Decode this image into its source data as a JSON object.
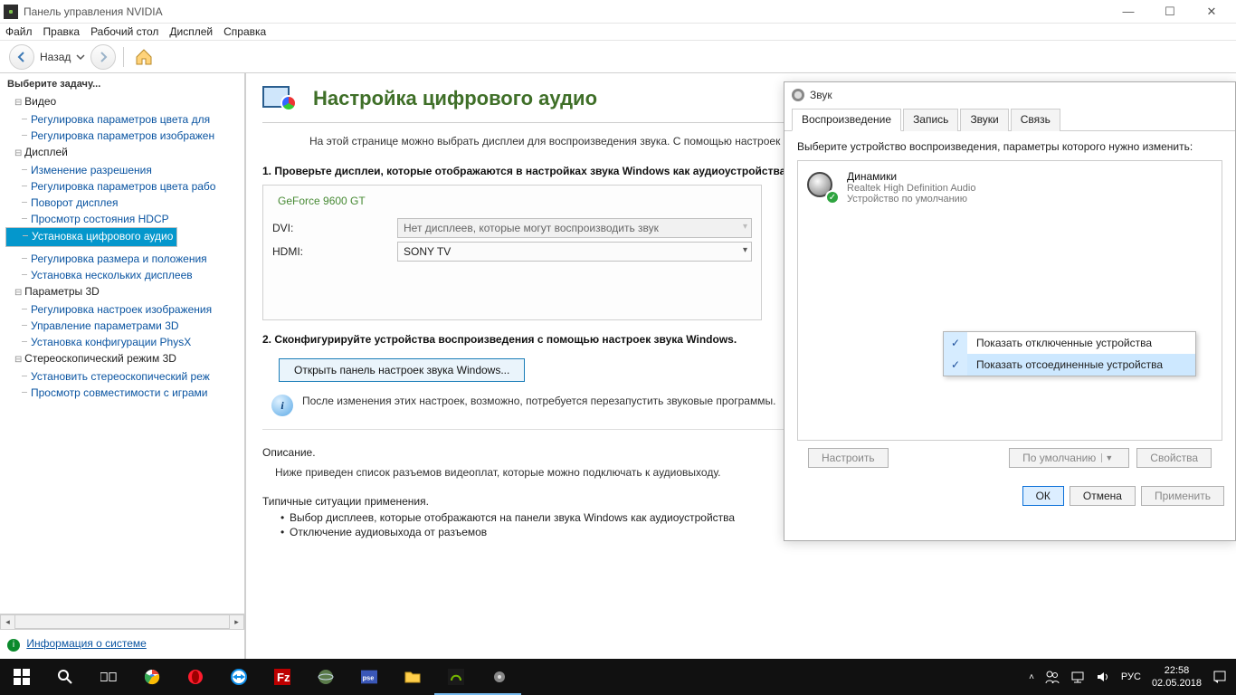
{
  "titlebar": {
    "title": "Панель управления NVIDIA"
  },
  "menubar": [
    "Файл",
    "Правка",
    "Рабочий стол",
    "Дисплей",
    "Справка"
  ],
  "nav": {
    "back": "Назад"
  },
  "leftpane_header": "Выберите задачу...",
  "tree": [
    {
      "group": "Видео",
      "items": [
        "Регулировка параметров цвета для",
        "Регулировка параметров изображен"
      ]
    },
    {
      "group": "Дисплей",
      "items": [
        "Изменение разрешения",
        "Регулировка параметров цвета рабо",
        "Поворот дисплея",
        "Просмотр состояния HDCP",
        "Установка цифрового аудио",
        "Регулировка размера и положения",
        "Установка нескольких дисплеев"
      ]
    },
    {
      "group": "Параметры 3D",
      "items": [
        "Регулировка настроек изображения",
        "Управление параметрами 3D",
        "Установка конфигурации PhysX"
      ]
    },
    {
      "group": "Стереоскопический режим 3D",
      "items": [
        "Установить стереоскопический реж",
        "Просмотр совместимости с играми"
      ]
    }
  ],
  "tree_selected": "Установка цифрового аудио",
  "sysinfo_link": "Информация о системе",
  "page": {
    "title": "Настройка цифрового аудио",
    "intro": "На этой странице можно выбрать дисплеи для воспроизведения звука. С помощью настроек звука Windows можно изменить настройки звука во время настройки.",
    "step1": "1. Проверьте дисплеи, которые отображаются в настройках звука Windows как аудиоустройства.",
    "card_name": "GeForce 9600 GT",
    "dvi_label": "DVI:",
    "dvi_value": "Нет дисплеев, которые могут воспроизводить звук",
    "hdmi_label": "HDMI:",
    "hdmi_value": "SONY TV",
    "step2": "2. Сконфигурируйте устройства воспроизведения с помощью настроек звука Windows.",
    "open_sound_btn": "Открыть панель настроек звука Windows...",
    "info_text": "После изменения этих настроек, возможно, потребуется перезапустить звуковые программы.",
    "desc_h": "Описание.",
    "desc_t": "Ниже приведен список разъемов видеоплат, которые можно подключать к аудиовыходу.",
    "situ_h": "Типичные ситуации применения.",
    "bul1": "Выбор дисплеев, которые отображаются на панели звука Windows как аудиоустройства",
    "bul2": "Отключение аудиовыхода от разъемов"
  },
  "sound": {
    "title": "Звук",
    "tabs": [
      "Воспроизведение",
      "Запись",
      "Звуки",
      "Связь"
    ],
    "active_tab": 0,
    "instruct": "Выберите устройство воспроизведения, параметры которого нужно изменить:",
    "device": {
      "name": "Динамики",
      "driver": "Realtek High Definition Audio",
      "status": "Устройство по умолчанию"
    },
    "ctx": [
      "Показать отключенные устройства",
      "Показать отсоединенные устройства"
    ],
    "btn_configure": "Настроить",
    "btn_default": "По умолчанию",
    "btn_props": "Свойства",
    "btn_ok": "ОК",
    "btn_cancel": "Отмена",
    "btn_apply": "Применить"
  },
  "taskbar": {
    "lang": "РУС",
    "time": "22:58",
    "date": "02.05.2018"
  }
}
